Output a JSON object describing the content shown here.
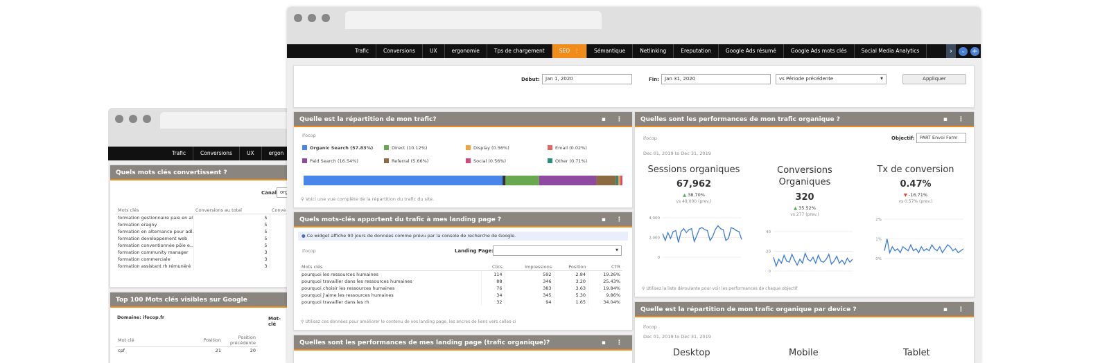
{
  "back": {
    "nav": [
      "Trafic",
      "Conversions",
      "UX",
      "ergon"
    ],
    "kw_panel": {
      "title": "Quels mots clés convertissent ?",
      "canal_label": "Canal:",
      "canal_value": "org",
      "columns": [
        "Mots clés",
        "Conversions au total",
        "Conve"
      ],
      "rows": [
        [
          "formation gestionnaire paie en al...",
          "5"
        ],
        [
          "formation eragny",
          "5"
        ],
        [
          "formation en alternance pour adl...",
          "5"
        ],
        [
          "formation developpement web",
          "5"
        ],
        [
          "formation conventionnée pôle e...",
          "5"
        ],
        [
          "formation community manager",
          "3"
        ],
        [
          "formation commerciale",
          "3"
        ],
        [
          "formation assistant rh rémunéré",
          "3"
        ]
      ]
    },
    "top_panel": {
      "title": "Top 100 Mots clés visibles sur Google",
      "domain": "Domaine: ifocop.fr",
      "motcle_label": "Mot-clé",
      "columns": [
        "Mot clé",
        "Position",
        "Position précédente"
      ],
      "rows": [
        [
          "cpf",
          "21",
          "20"
        ]
      ]
    }
  },
  "nav": [
    "Trafic",
    "Conversions",
    "UX",
    "ergonomie",
    "Tps de chargement",
    "SEO",
    "Sémantique",
    "Netlinking",
    "Ereputation",
    "Google Ads résumé",
    "Google Ads mots clés",
    "Social Media Analytics"
  ],
  "nav_active": "SEO",
  "filters": {
    "debut_label": "Début:",
    "debut_value": "Jan 1, 2020",
    "fin_label": "Fin:",
    "fin_value": "Jan 31, 2020",
    "compare_value": "vs Période précédente",
    "apply_label": "Appliquer"
  },
  "traffic_panel": {
    "title": "Quelle est la répartition de mon trafic?",
    "brand": "ifocop",
    "legend": [
      {
        "label": "Organic Search (57.83%)",
        "color": "#4a86e8",
        "pct": 57.83,
        "bold": true
      },
      {
        "label": "Direct (10.12%)",
        "color": "#6aa84f",
        "pct": 10.12
      },
      {
        "label": "Display (0.56%)",
        "color": "#f6a03a",
        "pct": 0.56
      },
      {
        "label": "Email (0.02%)",
        "color": "#e06666",
        "pct": 0.02
      },
      {
        "label": "Paid Search (16.54%)",
        "color": "#8e4a9e",
        "pct": 16.54
      },
      {
        "label": "Referral (5.66%)",
        "color": "#8c6b43",
        "pct": 5.66
      },
      {
        "label": "Social (0.56%)",
        "color": "#d6457c",
        "pct": 0.56
      },
      {
        "label": "Other (0.71%)",
        "color": "#2e8c7c",
        "pct": 0.71
      }
    ],
    "note": "Voici une vue complète de la répartition du trafic du site."
  },
  "landing_panel": {
    "title": "Quels mots-clés apportent du trafic à mes landing page ?",
    "info": "Ce widget affiche 90 jours de données comme prévu par la console de recherche de Google.",
    "brand": "ifocop",
    "landing_label": "Landing Page:",
    "columns": [
      "Mots clés",
      "Clics",
      "Impressions",
      "Position",
      "CTR"
    ],
    "rows": [
      [
        "pourquoi les ressources humaines",
        "114",
        "592",
        "2.84",
        "19.26%"
      ],
      [
        "pourquoi travailler dans les ressources humaines",
        "88",
        "346",
        "3.20",
        "25.43%"
      ],
      [
        "pourquoi choisir les ressources humaines",
        "76",
        "383",
        "3.63",
        "19.84%"
      ],
      [
        "pourquoi j'aime les ressources humaines",
        "34",
        "345",
        "5.30",
        "9.86%"
      ],
      [
        "pourquoi travailler dans les rh",
        "32",
        "94",
        "1.65",
        "34.04%"
      ]
    ],
    "note": "Utilisez ces données pour améliorer le contenu de vos landing page, les ancres de liens vers celles-ci"
  },
  "perf_landing_panel": {
    "title": "Quelles sont les performances de mes landing page (trafic organique)?"
  },
  "organic_panel": {
    "title": "Quelles sont les performances de mon trafic organique ?",
    "brand": "ifocop",
    "objectif_label": "Objectif:",
    "objectif_value": "PART Envoi Form",
    "date_range": "Dec 01, 2019 to Dec 31, 2019",
    "kpis": [
      {
        "title": "Sessions organiques",
        "value": "67,962",
        "delta": "38.70%",
        "up": true,
        "prev": "vs 49,000 (prev.)"
      },
      {
        "title": "Conversions Organiques",
        "value": "320",
        "delta": "35.52%",
        "up": true,
        "prev": "vs 277 (prev.)"
      },
      {
        "title": "Tx de conversion",
        "value": "0.47%",
        "delta": "-16.71%",
        "up": false,
        "prev": "vs 0.57% (prev.)"
      }
    ],
    "note": "Utilisez la liste déroulante pour voir les performances de chaque objectif"
  },
  "chart_data": [
    {
      "type": "line",
      "title": "",
      "ylim": [
        0,
        4000
      ],
      "yticks": [
        "0",
        "2,000",
        "4,000"
      ],
      "values": [
        2400,
        1700,
        2500,
        1900,
        2600,
        2700,
        1500,
        2600,
        2900,
        2500,
        2800,
        2900,
        1600,
        2200,
        2900,
        3000,
        2800,
        2700,
        1700,
        2100,
        2800,
        3200,
        2900,
        2800,
        1700,
        1900,
        3000,
        2900,
        2700,
        2600,
        1800
      ]
    },
    {
      "type": "line",
      "title": "",
      "ylim": [
        0,
        40
      ],
      "yticks": [
        "0",
        "20",
        "40"
      ],
      "values": [
        14,
        5,
        12,
        8,
        16,
        10,
        9,
        17,
        11,
        6,
        12,
        8,
        18,
        12,
        10,
        14,
        8,
        16,
        10,
        9,
        12,
        17,
        7,
        10,
        15,
        8,
        11,
        7,
        13,
        9,
        12
      ]
    },
    {
      "type": "line",
      "title": "",
      "ylim": [
        0,
        2
      ],
      "yticks": [
        "0%",
        "1%",
        "2%"
      ],
      "values": [
        0.4,
        1.0,
        0.3,
        0.6,
        0.4,
        0.5,
        0.3,
        0.6,
        0.5,
        0.4,
        0.7,
        0.4,
        0.5,
        0.3,
        0.6,
        0.4,
        0.5,
        0.4,
        0.7,
        0.5,
        0.4,
        0.6,
        0.3,
        0.5,
        0.7,
        0.6,
        0.4,
        0.5,
        0.3,
        0.4,
        0.5
      ]
    }
  ],
  "device_panel": {
    "title": "Quelle est la répartition de mon trafic organique par device ?",
    "brand": "ifocop",
    "date_range": "Dec 01, 2019 to Dec 31, 2019",
    "devices": [
      "Desktop",
      "Mobile",
      "Tablet"
    ]
  }
}
